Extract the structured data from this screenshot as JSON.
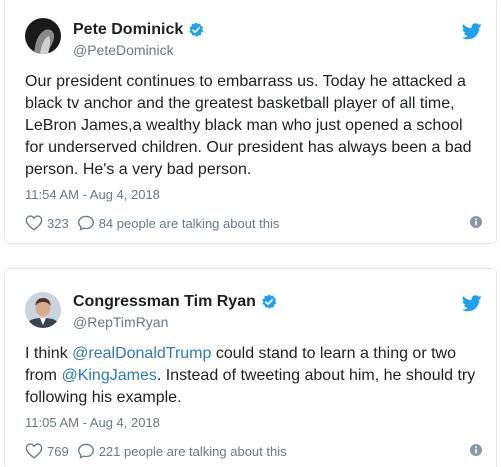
{
  "tweets": [
    {
      "display_name": "Pete Dominick",
      "handle": "@PeteDominick",
      "lines": [
        [
          {
            "t": "Our president continues to embarrass us. Today he attacked a"
          }
        ],
        [
          {
            "t": "black tv anchor and the greatest basketball player of all time,"
          }
        ],
        [
          {
            "t": "LeBron James,a wealthy black man who just opened a school"
          }
        ],
        [
          {
            "t": "for underserved children. Our president has always been a bad"
          }
        ],
        [
          {
            "t": "person. He's a very bad person."
          }
        ]
      ],
      "timestamp": "11:54 AM - Aug 4, 2018",
      "likes": "323",
      "replies": "84 people are talking about this"
    },
    {
      "display_name": "Congressman Tim Ryan",
      "handle": "@RepTimRyan",
      "lines": [
        [
          {
            "t": "I think "
          },
          {
            "t": "@realDonaldTrump",
            "link": true
          },
          {
            "t": " could stand to learn a thing or two"
          }
        ],
        [
          {
            "t": "from "
          },
          {
            "t": "@KingJames",
            "link": true
          },
          {
            "t": ". Instead of tweeting about him, he should try"
          }
        ],
        [
          {
            "t": "following his example."
          }
        ]
      ],
      "timestamp": "11:05 AM - Aug 4, 2018",
      "likes": "769",
      "replies": "221 people are talking about this"
    }
  ],
  "icons": {
    "verified": "verified-badge-icon",
    "bird": "twitter-bird-icon",
    "like": "heart-icon",
    "reply": "speech-bubble-icon",
    "info": "info-icon"
  },
  "colors": {
    "twitter_blue": "#1da1f2",
    "link": "#2b7bb9",
    "secondary_text": "#697882",
    "border": "#e1e8ed"
  }
}
